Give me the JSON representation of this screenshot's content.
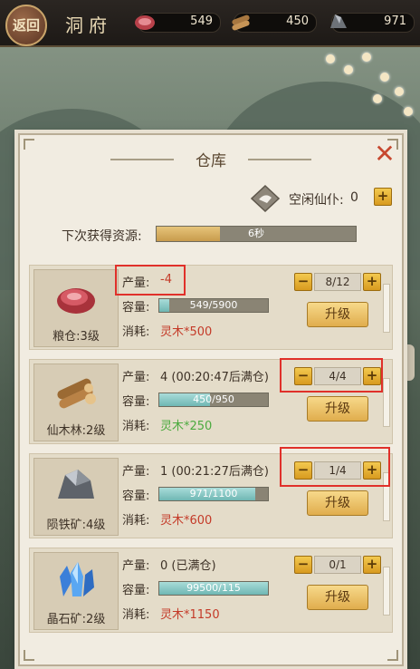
{
  "header": {
    "back_label": "返回",
    "title": "洞府",
    "resources": [
      {
        "icon": "meat-icon",
        "value": "549"
      },
      {
        "icon": "wood-icon",
        "value": "450"
      },
      {
        "icon": "iron-ore-icon",
        "value": "971"
      }
    ]
  },
  "panel": {
    "title": "仓库",
    "close_icon": "close-icon",
    "idle_label": "空闲仙仆:",
    "idle_count": "0",
    "next_label": "下次获得资源:",
    "next_time": "6秒",
    "next_progress": 0.32
  },
  "labels": {
    "produce": "产量:",
    "capacity": "容量:",
    "consume": "消耗:",
    "upgrade": "升级"
  },
  "rows": [
    {
      "name": "粮仓:3级",
      "icon": "meat-icon",
      "produce": "-4",
      "capacity": "549/5900",
      "cap_ratio": 0.093,
      "consume": "灵木*500",
      "stock": "8/12"
    },
    {
      "name": "仙木林:2级",
      "icon": "wood-icon",
      "produce": "4 (00:20:47后满仓)",
      "capacity": "450/950",
      "cap_ratio": 0.47,
      "consume": "灵木*250",
      "stock": "4/4"
    },
    {
      "name": "陨铁矿:4级",
      "icon": "iron-ore-icon",
      "produce": "1 (00:21:27后满仓)",
      "capacity": "971/1100",
      "cap_ratio": 0.88,
      "consume": "灵木*600",
      "stock": "1/4"
    },
    {
      "name": "晶石矿:2级",
      "icon": "crystal-icon",
      "produce": "0 (已满仓)",
      "capacity": "99500/115",
      "cap_ratio": 1.0,
      "consume": "灵木*1150",
      "stock": "0/1"
    }
  ],
  "colors": {
    "accent_red": "#c43a28",
    "consume_green": "#4caa3f",
    "highlight": "#e0302a"
  }
}
